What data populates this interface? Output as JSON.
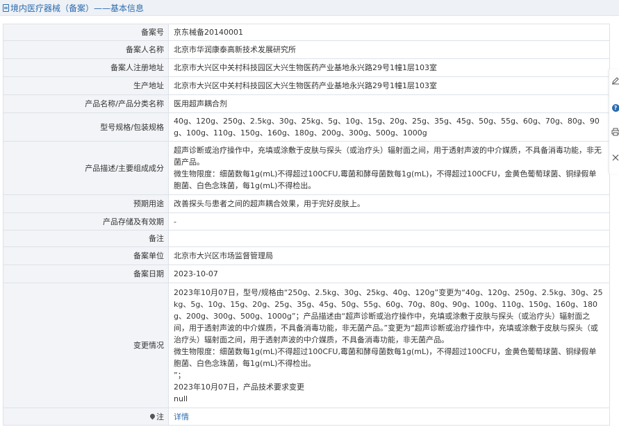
{
  "header": {
    "title": "境内医疗器械（备案）——基本信息"
  },
  "rows": [
    {
      "label": "备案号",
      "lines": [
        "京东械备20140001"
      ]
    },
    {
      "label": "备案人名称",
      "lines": [
        "北京市华润康泰高新技术发展研究所"
      ]
    },
    {
      "label": "备案人注册地址",
      "lines": [
        "北京市大兴区中关村科技园区大兴生物医药产业基地永兴路29号1幢1层103室"
      ]
    },
    {
      "label": "生产地址",
      "lines": [
        "北京市大兴区中关村科技园区大兴生物医药产业基地永兴路29号1幢1层103室"
      ]
    },
    {
      "label": "产品名称/产品分类名称",
      "lines": [
        "医用超声耦合剂"
      ]
    },
    {
      "label": "型号规格/包装规格",
      "lines": [
        "40g、120g、250g、2.5kg、30g、25kg、5g、10g、15g、20g、25g、35g、45g、50g、55g、60g、70g、80g、90g、100g、110g、150g、160g、180g、200g、300g、500g、1000g"
      ]
    },
    {
      "label": "产品描述/主要组成成分",
      "lines": [
        "超声诊断或治疗操作中，充填或涂敷于皮肤与探头（或治疗头）辐射面之间，用于透射声波的中介媒质，不具备消毒功能，非无菌产品。",
        "微生物限度：细菌数每1g(mL)不得超过100CFU,霉菌和酵母菌数每1g(mL)，不得超过100CFU，金黄色葡萄球菌、铜绿假单胞菌、白色念珠菌，每1g(mL)不得检出。"
      ]
    },
    {
      "label": "预期用途",
      "lines": [
        "改善探头与患者之间的超声耦合效果，用于完好皮肤上。"
      ]
    },
    {
      "label": "产品存储及有效期",
      "lines": [
        "-"
      ]
    },
    {
      "label": "备注",
      "lines": [
        ""
      ]
    },
    {
      "label": "备案单位",
      "lines": [
        "北京市大兴区市场监督管理局"
      ]
    },
    {
      "label": "备案日期",
      "lines": [
        "2023-10-07"
      ]
    },
    {
      "label": "变更情况",
      "lines": [
        "2023年10月07日，型号/规格由“250g、2.5kg、30g、25kg、40g、120g”变更为“40g、120g、250g、2.5kg、30g、25kg、5g、10g、15g、20g、25g、35g、45g、50g、55g、60g、70g、80g、90g、100g、110g、150g、160g、180g、200g、300g、500g、1000g”；产品描述由“超声诊断或治疗操作中，充填或涂敷于皮肤与探头（或治疗头）辐射面之间，用于透射声波的中介媒质，不具备消毒功能，非无菌产品。”变更为“超声诊断或治疗操作中，充填或涂敷于皮肤与探头（或治疗头）辐射面之间，用于透射声波的中介媒质，不具备消毒功能，非无菌产品。",
        "微生物限度：细菌数每1g(mL)不得超过100CFU,霉菌和酵母菌数每1g(mL)，不得超过100CFU，金黄色葡萄球菌、铜绿假单胞菌、白色念珠菌，每1g(mL)不得检出。",
        "”；",
        "2023年10月07日，产品技术要求变更",
        "null"
      ]
    }
  ],
  "note": {
    "label": "注",
    "link": "详情"
  },
  "colors": {
    "accent": "#2b6cb0",
    "label_bg": "#f2f4f7",
    "border": "#dde2e8"
  },
  "side_tools": [
    "edit-icon",
    "help-icon",
    "print-icon",
    "close-icon"
  ]
}
